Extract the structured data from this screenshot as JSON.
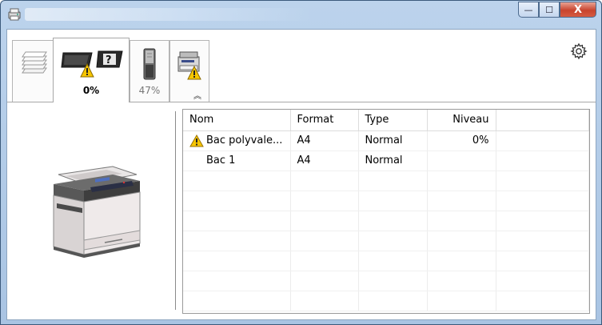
{
  "titlebar": {
    "minimize_glyph": "—",
    "maximize_glyph": "☐",
    "close_glyph": "X"
  },
  "tabs": [
    {
      "id": "paper",
      "icon": "paper-stack-icon",
      "label": ""
    },
    {
      "id": "toner",
      "icon": "toner-warning-icon",
      "label": "0%",
      "active": true
    },
    {
      "id": "waste",
      "icon": "waste-toner-icon",
      "label": "47%"
    },
    {
      "id": "device",
      "icon": "device-warning-icon",
      "label": ""
    }
  ],
  "collapse_glyph": "︽",
  "table": {
    "headers": {
      "name": "Nom",
      "format": "Format",
      "type": "Type",
      "level": "Niveau"
    },
    "rows": [
      {
        "warning": true,
        "name": "Bac polyvale...",
        "format": "A4",
        "type": "Normal",
        "level": "0%"
      },
      {
        "warning": false,
        "name": "Bac 1",
        "format": "A4",
        "type": "Normal",
        "level": ""
      }
    ],
    "empty_rows": 7
  },
  "colors": {
    "warning_yellow": "#f7c600",
    "accent_frame": "#a9c4e3",
    "close_red": "#c8442e"
  }
}
